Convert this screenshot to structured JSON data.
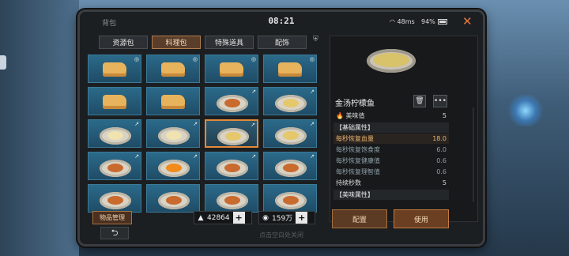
{
  "window": {
    "title": "背包",
    "clock": "08:21",
    "signal": "48ms",
    "battery": "94%"
  },
  "tabs": [
    {
      "label": "资源包",
      "active": false
    },
    {
      "label": "料理包",
      "active": true
    },
    {
      "label": "特殊道具",
      "active": false
    },
    {
      "label": "配饰",
      "active": false
    }
  ],
  "grid": {
    "items": [
      {
        "icon": "bread-icon",
        "tag": "◎"
      },
      {
        "icon": "bread-icon",
        "tag": "◎"
      },
      {
        "icon": "bread-icon",
        "tag": "◎"
      },
      {
        "icon": "bread-icon",
        "tag": "◎"
      },
      {
        "icon": "bread-icon",
        "tag": ""
      },
      {
        "icon": "bread-icon",
        "tag": ""
      },
      {
        "icon": "dish-icon",
        "tag": "↗"
      },
      {
        "icon": "fish-icon",
        "tag": "↗"
      },
      {
        "icon": "fillet-icon",
        "tag": "↗"
      },
      {
        "icon": "fillet-icon",
        "tag": "↗"
      },
      {
        "icon": "soup-icon",
        "tag": "↗",
        "selected": true
      },
      {
        "icon": "soup-icon",
        "tag": "↗"
      },
      {
        "icon": "dish-icon",
        "tag": "↗"
      },
      {
        "icon": "orange-icon",
        "tag": "↗"
      },
      {
        "icon": "dish-icon",
        "tag": "↗"
      },
      {
        "icon": "dish-icon",
        "tag": "↗"
      },
      {
        "icon": "dish-icon",
        "tag": ""
      },
      {
        "icon": "dish-icon",
        "tag": ""
      },
      {
        "icon": "dish-icon",
        "tag": ""
      },
      {
        "icon": "dish-icon",
        "tag": ""
      }
    ]
  },
  "footer": {
    "manage_label": "物品管理",
    "currency1": "42864",
    "currency2": "159万"
  },
  "detail": {
    "name": "金汤柠檬鱼",
    "flavor_label": "美味值",
    "flavor_value": "5",
    "basic_section": "【基础属性】",
    "stats": [
      {
        "label": "每秒恢复血量",
        "value": "18.0",
        "highlight": true
      },
      {
        "label": "每秒恢复饱食度",
        "value": "6.0"
      },
      {
        "label": "每秒恢复健康值",
        "value": "0.6"
      },
      {
        "label": "每秒恢复理智值",
        "value": "0.6"
      },
      {
        "label": "持续秒数",
        "value": "5",
        "white": true
      }
    ],
    "taste_section": "【美味属性】",
    "config_label": "配置",
    "use_label": "使用"
  },
  "bottom": {
    "hint": "点击空白处关闭"
  }
}
